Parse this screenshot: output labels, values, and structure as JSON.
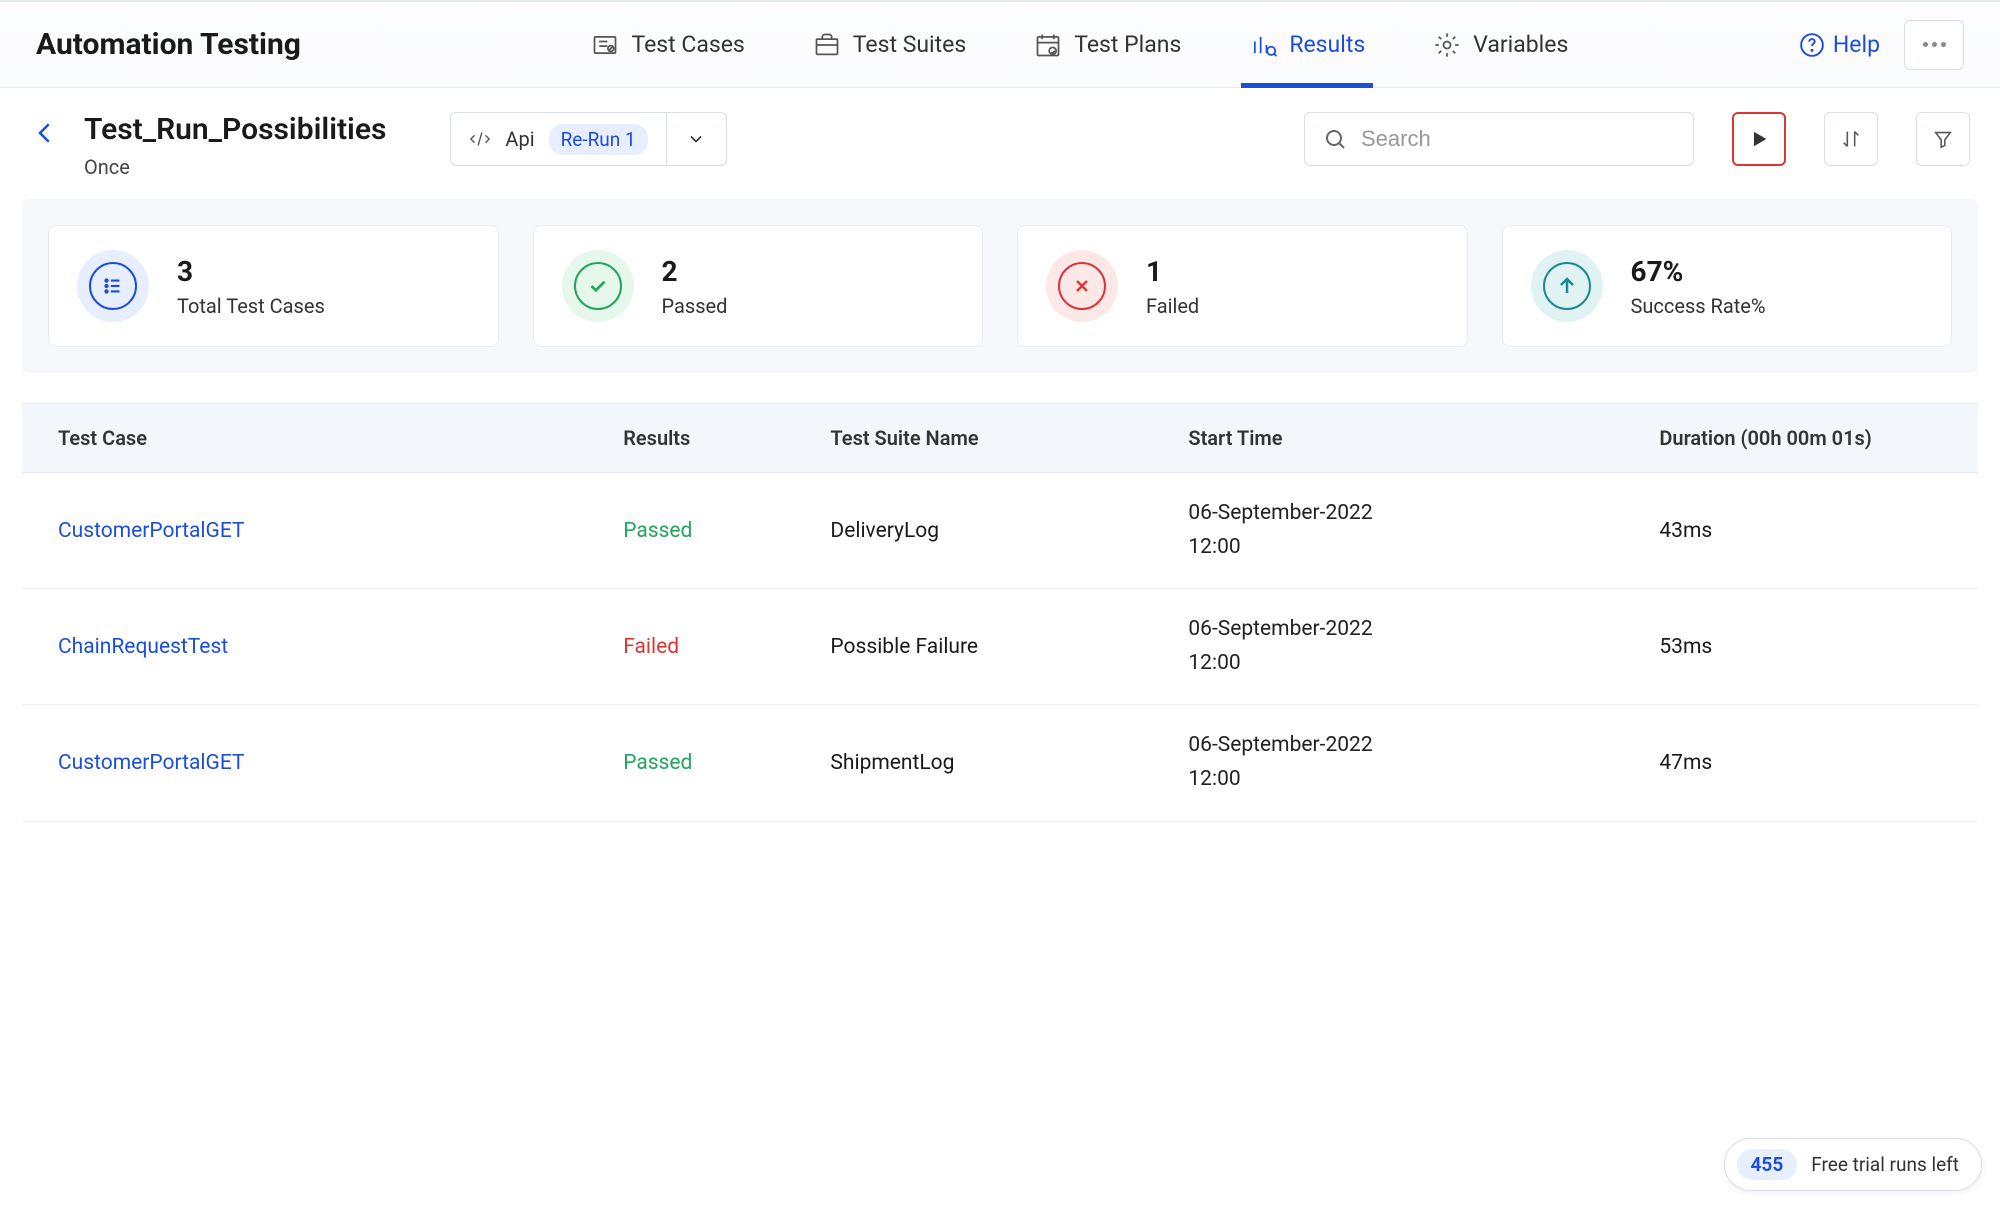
{
  "header": {
    "app_title": "Automation Testing",
    "help_label": "Help",
    "tabs": [
      {
        "label": "Test Cases"
      },
      {
        "label": "Test Suites"
      },
      {
        "label": "Test Plans"
      },
      {
        "label": "Results"
      },
      {
        "label": "Variables"
      }
    ]
  },
  "subheader": {
    "run_title": "Test_Run_Possibilities",
    "run_subtitle": "Once",
    "api_label": "Api",
    "rerun_label": "Re-Run 1",
    "search_placeholder": "Search"
  },
  "stats": {
    "total": {
      "value": "3",
      "label": "Total Test Cases"
    },
    "passed": {
      "value": "2",
      "label": "Passed"
    },
    "failed": {
      "value": "1",
      "label": "Failed"
    },
    "rate": {
      "value": "67%",
      "label": "Success Rate%"
    }
  },
  "table": {
    "headers": {
      "test_case": "Test Case",
      "results": "Results",
      "suite": "Test Suite Name",
      "start": "Start Time",
      "duration": "Duration (00h 00m 01s)"
    },
    "rows": [
      {
        "test_case": "CustomerPortalGET",
        "result": "Passed",
        "result_status": "passed",
        "suite": "DeliveryLog",
        "start_date": "06-September-2022",
        "start_time": "12:00",
        "duration": "43ms"
      },
      {
        "test_case": "ChainRequestTest",
        "result": "Failed",
        "result_status": "failed",
        "suite": "Possible Failure",
        "start_date": "06-September-2022",
        "start_time": "12:00",
        "duration": "53ms"
      },
      {
        "test_case": "CustomerPortalGET",
        "result": "Passed",
        "result_status": "passed",
        "suite": "ShipmentLog",
        "start_date": "06-September-2022",
        "start_time": "12:00",
        "duration": "47ms"
      }
    ]
  },
  "trial": {
    "count": "455",
    "text": "Free trial runs left"
  }
}
